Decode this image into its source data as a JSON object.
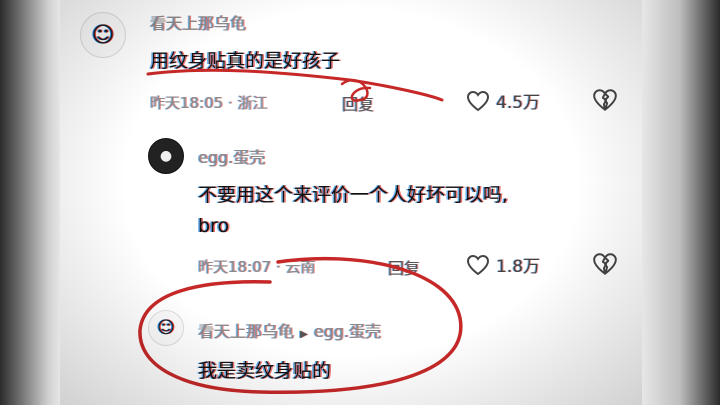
{
  "comments": [
    {
      "username": "看天上那乌龟",
      "text": "用纹身贴真的是好孩子",
      "time": "昨天18:05",
      "location": "浙江",
      "reply_label": "回复",
      "likes": "4.5万"
    },
    {
      "username": "egg.蛋壳",
      "text_line1": "不要用这个来评价一个人好坏可以吗,",
      "text_line2": "bro",
      "time": "昨天18:07",
      "location": "云南",
      "reply_label": "回复",
      "likes": "1.8万"
    },
    {
      "username": "看天上那乌龟",
      "reply_to": "egg.蛋壳",
      "text": "我是卖纹身贴的"
    }
  ],
  "meta_separator": " · ",
  "colors": {
    "annotation": "#c62828",
    "text": "#111111",
    "meta": "#8a8a8a"
  }
}
